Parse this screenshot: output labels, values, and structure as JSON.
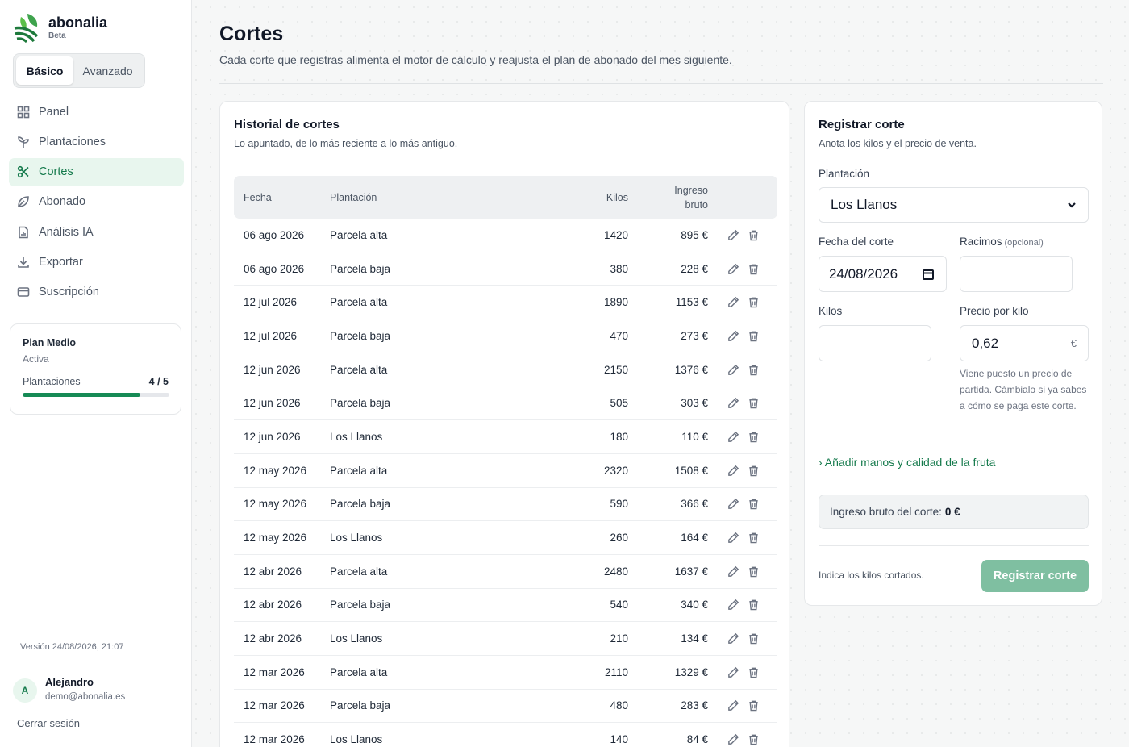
{
  "brand": {
    "name": "abonalia",
    "badge": "Beta"
  },
  "mode_switch": {
    "basic": "Básico",
    "advanced": "Avanzado"
  },
  "nav": [
    {
      "label": "Panel",
      "icon": "grid-icon"
    },
    {
      "label": "Plantaciones",
      "icon": "sprout-icon"
    },
    {
      "label": "Cortes",
      "icon": "scissors-icon",
      "active": true
    },
    {
      "label": "Abonado",
      "icon": "leaf-icon"
    },
    {
      "label": "Análisis IA",
      "icon": "report-icon"
    },
    {
      "label": "Exportar",
      "icon": "download-icon"
    },
    {
      "label": "Suscripción",
      "icon": "card-icon"
    }
  ],
  "plan": {
    "name": "Plan Medio",
    "status": "Activa",
    "label": "Plantaciones",
    "count": "4 / 5",
    "progress": 0.8
  },
  "version": "Versión 24/08/2026, 21:07",
  "user": {
    "initial": "A",
    "name": "Alejandro",
    "email": "demo@abonalia.es",
    "logout": "Cerrar sesión"
  },
  "page": {
    "title": "Cortes",
    "subtitle": "Cada corte que registras alimenta el motor de cálculo y reajusta el plan de abonado del mes siguiente."
  },
  "history": {
    "title": "Historial de cortes",
    "subtitle": "Lo apuntado, de lo más reciente a lo más antiguo.",
    "columns": {
      "date": "Fecha",
      "plantation": "Plantación",
      "kilos": "Kilos",
      "income_1": "Ingreso",
      "income_2": "bruto"
    },
    "rows": [
      [
        "06 ago 2026",
        "Parcela alta",
        "1420",
        "895 €"
      ],
      [
        "06 ago 2026",
        "Parcela baja",
        "380",
        "228 €"
      ],
      [
        "12 jul 2026",
        "Parcela alta",
        "1890",
        "1153 €"
      ],
      [
        "12 jul 2026",
        "Parcela baja",
        "470",
        "273 €"
      ],
      [
        "12 jun 2026",
        "Parcela alta",
        "2150",
        "1376 €"
      ],
      [
        "12 jun 2026",
        "Parcela baja",
        "505",
        "303 €"
      ],
      [
        "12 jun 2026",
        "Los Llanos",
        "180",
        "110 €"
      ],
      [
        "12 may 2026",
        "Parcela alta",
        "2320",
        "1508 €"
      ],
      [
        "12 may 2026",
        "Parcela baja",
        "590",
        "366 €"
      ],
      [
        "12 may 2026",
        "Los Llanos",
        "260",
        "164 €"
      ],
      [
        "12 abr 2026",
        "Parcela alta",
        "2480",
        "1637 €"
      ],
      [
        "12 abr 2026",
        "Parcela baja",
        "540",
        "340 €"
      ],
      [
        "12 abr 2026",
        "Los Llanos",
        "210",
        "134 €"
      ],
      [
        "12 mar 2026",
        "Parcela alta",
        "2110",
        "1329 €"
      ],
      [
        "12 mar 2026",
        "Parcela baja",
        "480",
        "283 €"
      ],
      [
        "12 mar 2026",
        "Los Llanos",
        "140",
        "84 €"
      ]
    ]
  },
  "form": {
    "title": "Registrar corte",
    "subtitle": "Anota los kilos y el precio de venta.",
    "plantation_label": "Plantación",
    "plantation_value": "Los Llanos",
    "date_label": "Fecha del corte",
    "date_value": "24/08/2026",
    "bunches_label": "Racimos",
    "bunches_optional": "(opcional)",
    "bunches_value": "",
    "kilos_label": "Kilos",
    "kilos_value": "",
    "price_label": "Precio por kilo",
    "price_value": "0,62",
    "price_unit": "€",
    "price_hint": "Viene puesto un precio de partida. Cámbialo si ya sabes a cómo se paga este corte.",
    "add_link": "› Añadir manos y calidad de la fruta",
    "gross_label": "Ingreso bruto del corte:",
    "gross_value": "0 €",
    "note": "Indica los kilos cortados.",
    "submit": "Registrar corte"
  },
  "colors": {
    "accent": "#157a4c",
    "accent_soft": "#e8f6ee",
    "button_disabled": "#7fbfa1"
  }
}
